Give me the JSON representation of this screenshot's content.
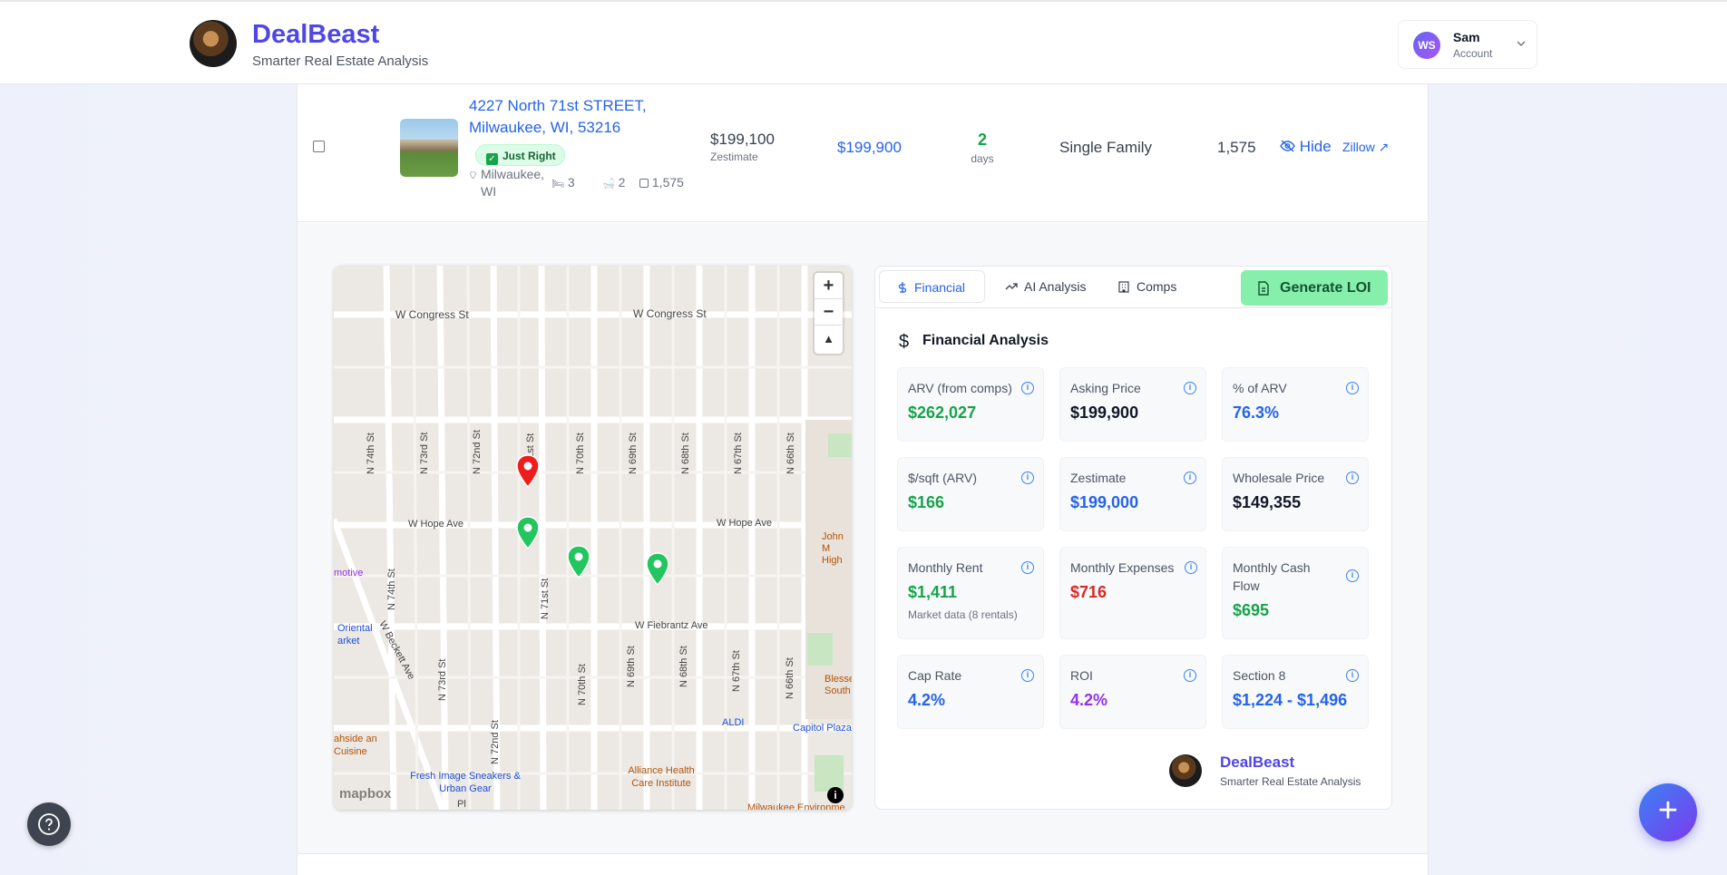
{
  "header": {
    "brand": "DealBeast",
    "tagline": "Smarter Real Estate Analysis",
    "account": {
      "initials": "WS",
      "name": "Sam",
      "label": "Account"
    }
  },
  "property": {
    "address": "4227 North 71st STREET, Milwaukee, WI, 53216",
    "badge": "Just Right",
    "location": "Milwaukee, WI",
    "beds": "3",
    "baths": "2",
    "sqft_small": "1,575",
    "zestimate_value": "$199,100",
    "zestimate_label": "Zestimate",
    "list_price": "$199,900",
    "days_value": "2",
    "days_label": "days",
    "type": "Single Family",
    "sqft": "1,575",
    "hide_label": "Hide",
    "zillow_label": "Zillow"
  },
  "map": {
    "streets_horizontal": [
      "W Congress St",
      "W Congress St",
      "W Hope Ave",
      "W Hope Ave",
      "W Fiebrantz Ave"
    ],
    "streets_vertical": [
      "N 74th St",
      "N 73rd St",
      "N 72nd St",
      "N 71st St",
      "N 70th St",
      "N 69th St",
      "N 68th St",
      "N 67th St",
      "N 66th St",
      "N 74th St",
      "N 71st St",
      "N 73rd St",
      "N 72nd St",
      "N 70th St",
      "N 69th St",
      "N 68th St",
      "N 67th St",
      "N 66th St",
      "W Beckett Ave"
    ],
    "pois": [
      "John M High",
      "Oriental arket",
      "motive",
      "Blesse South",
      "ALDI",
      "Capitol Plaza",
      "Alliance Health Care Institute",
      "Fresh Image Sneakers & Urban Gear",
      "ahside an Cuisine",
      "Milwaukee Environme",
      "Pl"
    ],
    "zoom_in": "+",
    "zoom_out": "−",
    "compass": "▲",
    "attribution": "mapbox",
    "info": "i"
  },
  "tabs": [
    {
      "label": "Financial",
      "icon": "dollar-icon"
    },
    {
      "label": "AI Analysis",
      "icon": "trending-icon"
    },
    {
      "label": "Comps",
      "icon": "building-icon"
    }
  ],
  "generate_loi": "Generate LOI",
  "financial": {
    "title": "Financial Analysis",
    "cards": [
      {
        "label": "ARV (from comps)",
        "value": "$262,027",
        "color": "#16a34a"
      },
      {
        "label": "Asking Price",
        "value": "$199,900",
        "color": "#111827"
      },
      {
        "label": "% of ARV",
        "value": "76.3%",
        "color": "#2563eb"
      },
      {
        "label": "$/sqft (ARV)",
        "value": "$166",
        "color": "#16a34a"
      },
      {
        "label": "Zestimate",
        "value": "$199,000",
        "color": "#2563eb"
      },
      {
        "label": "Wholesale Price",
        "value": "$149,355",
        "color": "#111827"
      },
      {
        "label": "Monthly Rent",
        "value": "$1,411",
        "note": "Market data (8 rentals)",
        "color": "#16a34a"
      },
      {
        "label": "Monthly Expenses",
        "value": "$716",
        "color": "#dc2626"
      },
      {
        "label": "Monthly Cash Flow",
        "value": "$695",
        "color": "#16a34a"
      },
      {
        "label": "Cap Rate",
        "value": "4.2%",
        "color": "#2563eb"
      },
      {
        "label": "ROI",
        "value": "4.2%",
        "color": "#9333ea"
      },
      {
        "label": "Section 8",
        "value": "$1,224 - $1,496",
        "color": "#2563eb"
      }
    ],
    "footer_brand": "DealBeast",
    "footer_tagline": "Smarter Real Estate Analysis"
  }
}
